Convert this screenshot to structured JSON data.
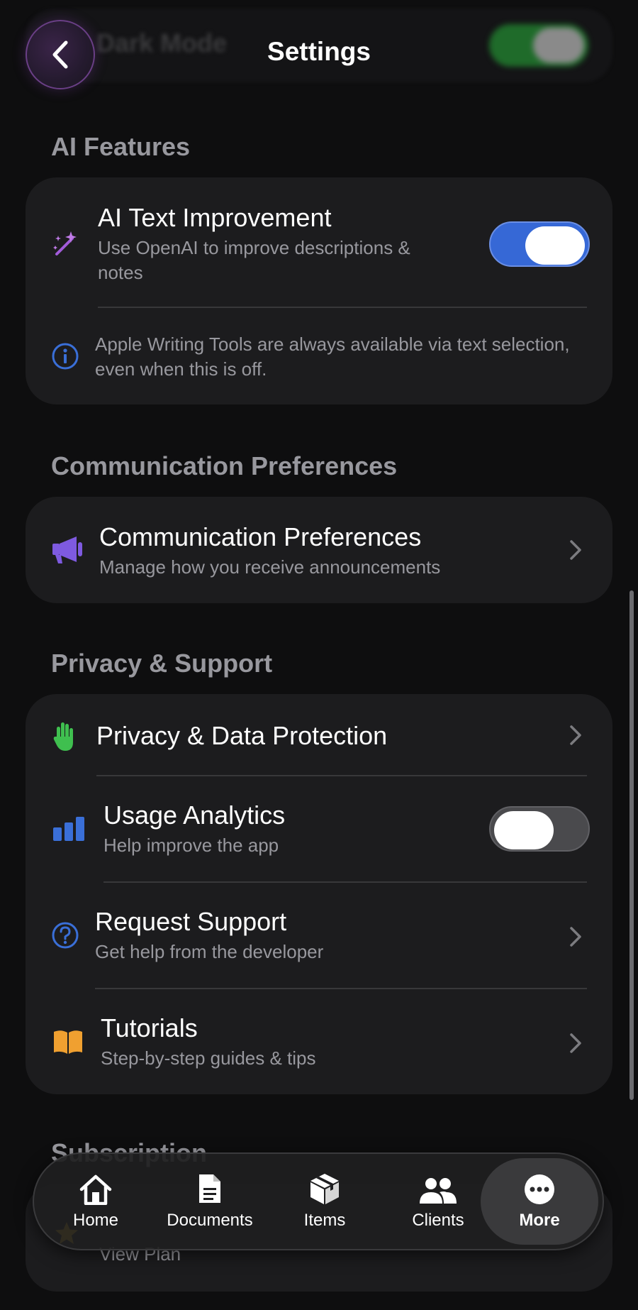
{
  "header": {
    "title": "Settings",
    "behind_row_label": "Dark Mode"
  },
  "ai_features": {
    "section_title": "AI Features",
    "text_improvement": {
      "title": "AI Text Improvement",
      "subtitle": "Use OpenAI to improve descriptions & notes",
      "enabled": true
    },
    "note": "Apple Writing Tools are always available via text selection, even when this is off."
  },
  "communication": {
    "section_title": "Communication Preferences",
    "row": {
      "title": "Communication Preferences",
      "subtitle": "Manage how you receive announcements"
    }
  },
  "privacy_support": {
    "section_title": "Privacy & Support",
    "items": [
      {
        "title": "Privacy & Data Protection",
        "subtitle": ""
      },
      {
        "title": "Usage Analytics",
        "subtitle": "Help improve the app",
        "enabled": false
      },
      {
        "title": "Request Support",
        "subtitle": "Get help from the developer"
      },
      {
        "title": "Tutorials",
        "subtitle": "Step-by-step guides & tips"
      }
    ]
  },
  "subscription": {
    "section_title": "Subscription",
    "view_plan": "View Plan"
  },
  "tabbar": {
    "tabs": [
      {
        "label": "Home",
        "icon": "house-icon"
      },
      {
        "label": "Documents",
        "icon": "document-icon"
      },
      {
        "label": "Items",
        "icon": "box-icon"
      },
      {
        "label": "Clients",
        "icon": "people-icon"
      },
      {
        "label": "More",
        "icon": "ellipsis-icon"
      }
    ],
    "active": "More"
  },
  "colors": {
    "background": "#0e0e0f",
    "card": "#1c1c1e",
    "toggle_on": "#3668d6",
    "accent_purple": "#8e5bd9",
    "accent_green": "#3fbf4f",
    "accent_blue": "#3a6fd8",
    "accent_orange": "#f0a030"
  }
}
